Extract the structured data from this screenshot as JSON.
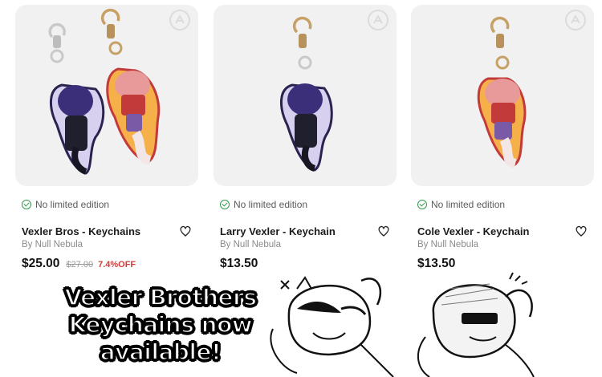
{
  "products": [
    {
      "edition_note": "No limited edition",
      "title": "Vexler Bros - Keychains",
      "byline": "By Null Nebula",
      "price": "$25.00",
      "old_price": "$27.00",
      "discount": "7.4%OFF"
    },
    {
      "edition_note": "No limited edition",
      "title": "Larry Vexler - Keychain",
      "byline": "By Null Nebula",
      "price": "$13.50",
      "old_price": "",
      "discount": ""
    },
    {
      "edition_note": "No limited edition",
      "title": "Cole Vexler - Keychain",
      "byline": "By Null Nebula",
      "price": "$13.50",
      "old_price": "",
      "discount": ""
    }
  ],
  "banner": {
    "line1": "Vexler Brothers",
    "line2": "Keychains now",
    "line3": "available!"
  },
  "colors": {
    "card_bg": "#f1f1f1",
    "check_green": "#2f9a4a",
    "discount_red": "#d23b3b",
    "purple_charm": "#3b2f7a",
    "red_charm": "#c23a3a",
    "silver_chain": "#c9c9c9",
    "gold_chain": "#c7a066"
  },
  "icons": [
    "ar-view-icon",
    "check-circle-icon",
    "heart-icon"
  ]
}
